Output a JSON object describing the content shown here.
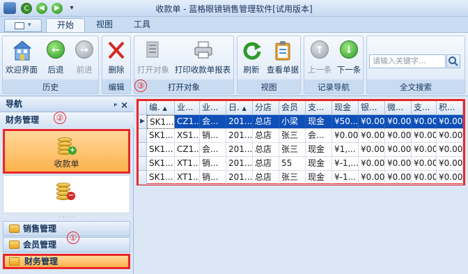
{
  "window": {
    "title": "收款单 - 蓝格眼镜销售管理软件[试用版本]"
  },
  "ribbon": {
    "tabs": [
      {
        "label": "开始"
      },
      {
        "label": "视图"
      },
      {
        "label": "工具"
      }
    ],
    "groups": {
      "history": {
        "label": "历史",
        "buttons": {
          "welcome": "欢迎界面",
          "back": "后退",
          "forward": "前进"
        }
      },
      "edit": {
        "label": "编辑",
        "buttons": {
          "delete": "删除"
        }
      },
      "open": {
        "label": "打开对象",
        "buttons": {
          "open": "打开对象",
          "print": "打印收款单报表"
        }
      },
      "view": {
        "label": "视图",
        "buttons": {
          "refresh": "刷新",
          "view_doc": "查看单据"
        }
      },
      "nav": {
        "label": "记录导航",
        "buttons": {
          "prev": "上一条",
          "next": "下一条"
        }
      },
      "search": {
        "label": "全文搜索",
        "placeholder": "请输入关键字..."
      }
    }
  },
  "nav": {
    "title": "导航",
    "pin": "ᴾ",
    "close": "×",
    "section": "财务管理",
    "items": [
      {
        "label": "收款单"
      },
      {
        "label": ""
      }
    ],
    "groups": [
      {
        "label": "销售管理"
      },
      {
        "label": "会员管理"
      },
      {
        "label": "财务管理"
      }
    ]
  },
  "annotations": [
    "①",
    "②",
    "③"
  ],
  "grid": {
    "columns": [
      "编.",
      "业...",
      "业...",
      "日.",
      "分店",
      "会员",
      "支...",
      "现金",
      "银...",
      "微...",
      "支...",
      "积..."
    ],
    "rows": [
      [
        "SK1...",
        "CZ1...",
        "会...",
        "201...",
        "总店",
        "小梁",
        "现金",
        "¥50...",
        "¥0.00",
        "¥0.00",
        "¥0.00",
        "¥0.00"
      ],
      [
        "SK1...",
        "XS1...",
        "销...",
        "201...",
        "总店",
        "张三",
        "会...",
        "¥0.00",
        "¥0.00",
        "¥0.00",
        "¥0.00",
        "¥0.00"
      ],
      [
        "SK1...",
        "CZ1...",
        "会...",
        "201...",
        "总店",
        "张三",
        "现金",
        "¥1,...",
        "¥0.00",
        "¥0.00",
        "¥0.00",
        "¥0.00"
      ],
      [
        "SK1...",
        "XT1...",
        "销...",
        "201...",
        "总店",
        "55",
        "现金",
        "¥-1,...",
        "¥0.00",
        "¥0.00",
        "¥0.00",
        "¥0.00"
      ],
      [
        "SK1...",
        "XT1...",
        "销...",
        "201...",
        "总店",
        "张三",
        "现金",
        "¥-1...",
        "¥0.00",
        "¥0.00",
        "¥0.00",
        "¥0.00"
      ]
    ]
  }
}
